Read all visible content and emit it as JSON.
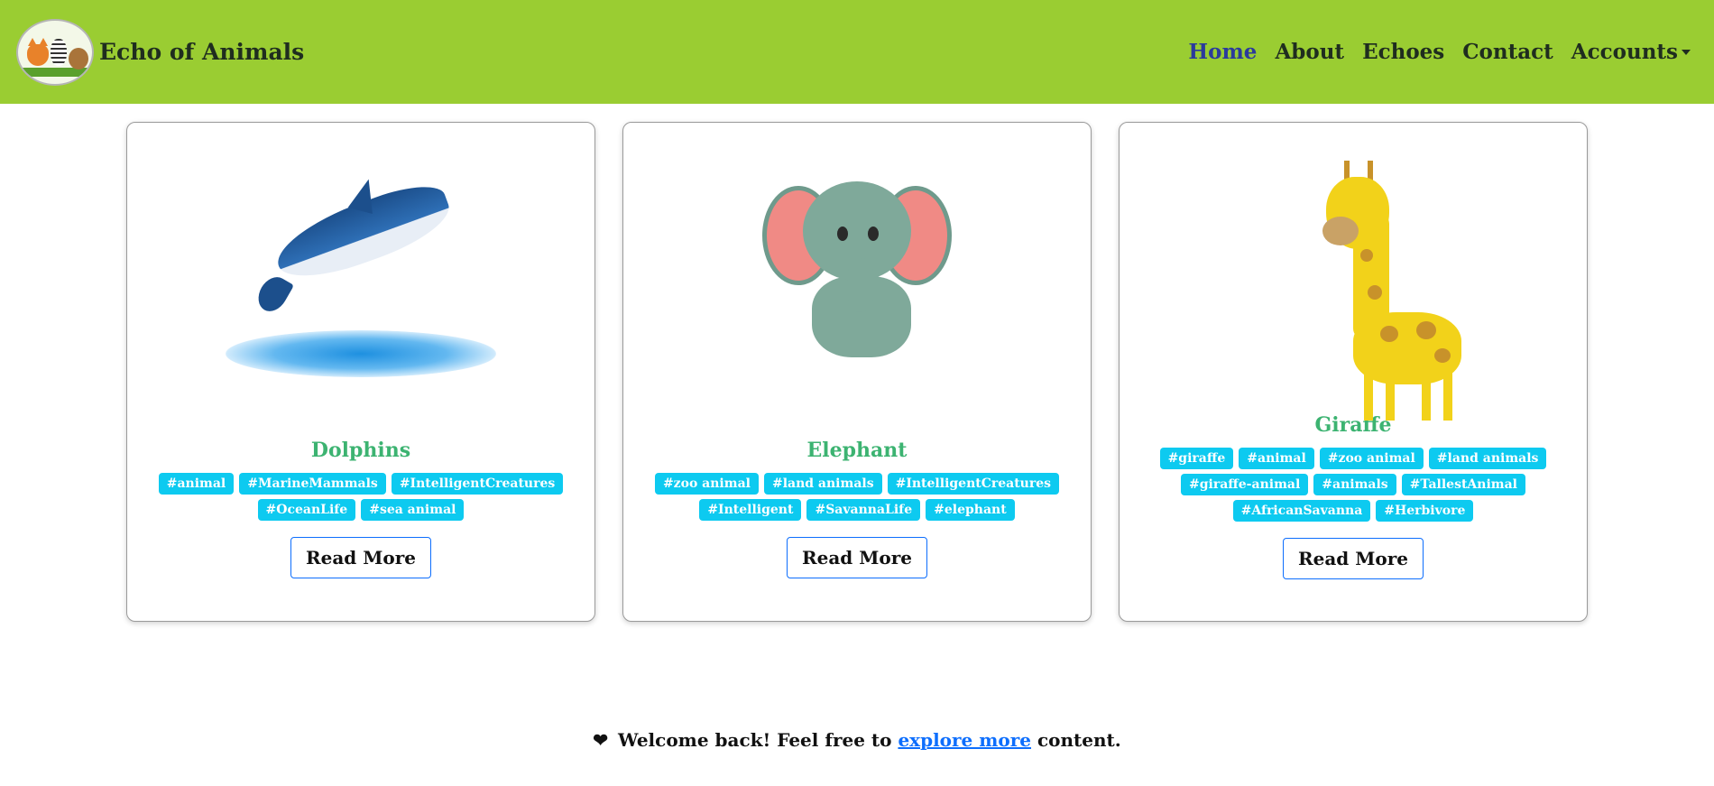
{
  "header": {
    "brand": "Echo of Animals",
    "logo_icon": "animals-logo-icon",
    "nav": [
      {
        "label": "Home",
        "active": true
      },
      {
        "label": "About",
        "active": false
      },
      {
        "label": "Echoes",
        "active": false
      },
      {
        "label": "Contact",
        "active": false
      },
      {
        "label": "Accounts",
        "active": false,
        "dropdown": true
      }
    ]
  },
  "cards": [
    {
      "title": "Dolphins",
      "image_icon": "dolphin-illustration",
      "tags": [
        "#animal",
        "#MarineMammals",
        "#IntelligentCreatures",
        "#OceanLife",
        "#sea animal"
      ],
      "button": "Read More"
    },
    {
      "title": "Elephant",
      "image_icon": "elephant-illustration",
      "tags": [
        "#zoo animal",
        "#land animals",
        "#IntelligentCreatures",
        "#Intelligent",
        "#SavannaLife",
        "#elephant"
      ],
      "button": "Read More"
    },
    {
      "title": "Giraffe",
      "image_icon": "giraffe-illustration",
      "tags": [
        "#giraffe",
        "#animal",
        "#zoo animal",
        "#land animals",
        "#giraffe-animal",
        "#animals",
        "#TallestAnimal",
        "#AfricanSavanna",
        "#Herbivore"
      ],
      "button": "Read More"
    }
  ],
  "footer": {
    "heart_icon": "heart-icon",
    "welcome_prefix": "Welcome back! Feel free to",
    "link_text": "explore more",
    "welcome_suffix": "content."
  },
  "colors": {
    "navbar": "#9acd32",
    "active_nav": "#2b3a9c",
    "card_title": "#3cb371",
    "tag_bg": "#0dcaf0",
    "button_border": "#0d6efd"
  }
}
